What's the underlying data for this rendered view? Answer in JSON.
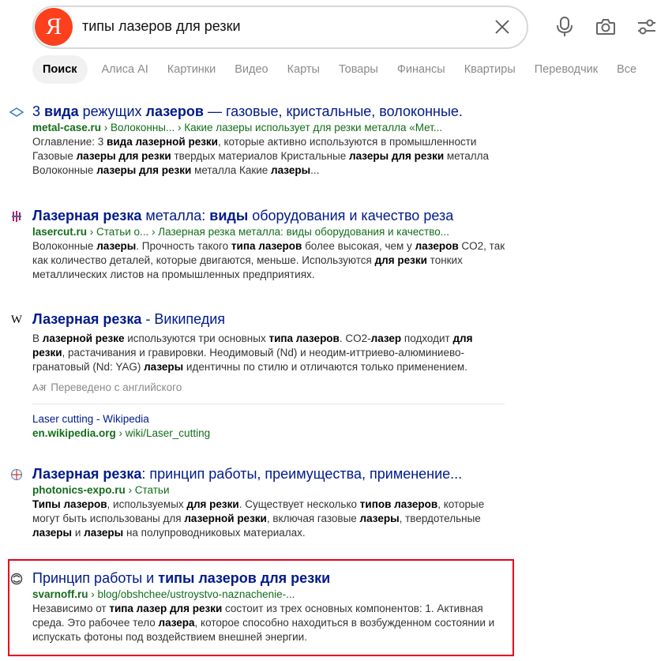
{
  "search": {
    "logo_letter": "Я",
    "query": "типы лазеров для резки"
  },
  "icons": {
    "clear": "close-icon",
    "voice": "microphone-icon",
    "camera": "camera-icon",
    "filters": "filters-icon"
  },
  "tabs": [
    {
      "label": "Поиск",
      "active": true
    },
    {
      "label": "Алиса AI"
    },
    {
      "label": "Картинки"
    },
    {
      "label": "Видео"
    },
    {
      "label": "Карты"
    },
    {
      "label": "Товары"
    },
    {
      "label": "Финансы"
    },
    {
      "label": "Квартиры"
    },
    {
      "label": "Переводчик"
    },
    {
      "label": "Все"
    }
  ],
  "results": [
    {
      "title_parts": [
        [
          "3 ",
          false
        ],
        [
          "вида",
          true
        ],
        [
          " режущих ",
          false
        ],
        [
          "лазеров",
          true
        ],
        [
          " — газовые, кристальные, волоконные.",
          false
        ]
      ],
      "host": "metal-case.ru",
      "path": " › Волоконны... › Какие лазеры использует для резки металла «Мет...",
      "snippet_parts": [
        [
          "Оглавление: 3 ",
          false
        ],
        [
          "вида лазерной резки",
          true
        ],
        [
          ", которые активно используются в промышленности Газовые ",
          false
        ],
        [
          "лазеры для резки",
          true
        ],
        [
          " твердых материалов Кристальные ",
          false
        ],
        [
          "лазеры для резки",
          true
        ],
        [
          " металла Волоконные ",
          false
        ],
        [
          "лазеры для резки",
          true
        ],
        [
          " металла Какие ",
          false
        ],
        [
          "лазеры",
          true
        ],
        [
          "...",
          false
        ]
      ]
    },
    {
      "title_parts": [
        [
          "Лазерная резка",
          true
        ],
        [
          " металла: ",
          false
        ],
        [
          "виды",
          true
        ],
        [
          " оборудования и качество реза",
          false
        ]
      ],
      "host": "lasercut.ru",
      "path": " › Статьи о... › Лазерная резка металла: виды оборудования и качество...",
      "snippet_parts": [
        [
          "Волоконные ",
          false
        ],
        [
          "лазеры",
          true
        ],
        [
          ". Прочность такого ",
          false
        ],
        [
          "типа лазеров",
          true
        ],
        [
          " более высокая, чем у ",
          false
        ],
        [
          "лазеров",
          true
        ],
        [
          " CO2, так как количество деталей, которые двигаются, меньше. Используются ",
          false
        ],
        [
          "для резки",
          true
        ],
        [
          " тонких металлических листов на промышленных предприятиях.",
          false
        ]
      ]
    },
    {
      "title_parts": [
        [
          "Лазерная резка",
          true
        ],
        [
          " - Википедия",
          false
        ]
      ],
      "snippet_parts": [
        [
          "В ",
          false
        ],
        [
          "лазерной резке",
          true
        ],
        [
          " используются три основных ",
          false
        ],
        [
          "типа лазеров",
          true
        ],
        [
          ". CO2-",
          false
        ],
        [
          "лазер",
          true
        ],
        [
          " подходит ",
          false
        ],
        [
          "для резки",
          true
        ],
        [
          ", растачивания и гравировки. Неодимовый (Nd) и неодим-иттриево-алюминиево-гранатовый (Nd: YAG) ",
          false
        ],
        [
          "лазеры",
          true
        ],
        [
          " идентичны по стилю и отличаются только применением.",
          false
        ]
      ],
      "translated_label": "Переведено с английского",
      "original_title": "Laser cutting - Wikipedia",
      "original_host": "en.wikipedia.org",
      "original_path": " › wiki/Laser_cutting"
    },
    {
      "title_parts": [
        [
          "Лазерная резка",
          true
        ],
        [
          ": принцип работы, преимущества, применение...",
          false
        ]
      ],
      "host": "photonics-expo.ru",
      "path": " › Статьи",
      "snippet_parts": [
        [
          "Типы лазеров",
          true
        ],
        [
          ", используемых ",
          false
        ],
        [
          "для резки",
          true
        ],
        [
          ". Существует несколько ",
          false
        ],
        [
          "типов лазеров",
          true
        ],
        [
          ", которые могут быть использованы для ",
          false
        ],
        [
          "лазерной резки",
          true
        ],
        [
          ", включая газовые ",
          false
        ],
        [
          "лазеры",
          true
        ],
        [
          ", твердотельные ",
          false
        ],
        [
          "лазеры",
          true
        ],
        [
          " и ",
          false
        ],
        [
          "лазеры",
          true
        ],
        [
          " на полупроводниковых материалах.",
          false
        ]
      ]
    },
    {
      "title_parts": [
        [
          "Принцип работы и ",
          false
        ],
        [
          "типы лазеров для резки",
          true
        ]
      ],
      "host": "svarnoff.ru",
      "path": " › blog/obshchee/ustroystvo-naznachenie-...",
      "snippet_parts": [
        [
          "Независимо от ",
          false
        ],
        [
          "типа лазер для резки",
          true
        ],
        [
          " состоит из трех основных компонентов: 1. Активная среда. Это рабочее тело ",
          false
        ],
        [
          "лазера",
          true
        ],
        [
          ", которое способно находиться в возбужденном состоянии и испускать фотоны под воздействием внешней энергии.",
          false
        ]
      ]
    }
  ],
  "colors": {
    "logo": "#fc3f1d",
    "title": "#001a8c",
    "url": "#136d1b",
    "highlight": "#e8001c"
  }
}
